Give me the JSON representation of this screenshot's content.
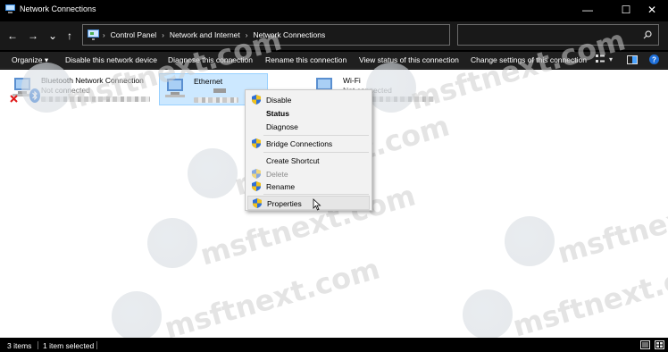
{
  "window": {
    "title": "Network Connections"
  },
  "window_controls": {
    "minimize": "—",
    "maximize": "☐",
    "close": "✕"
  },
  "nav": {
    "back": "←",
    "forward": "→",
    "recent": "⌄",
    "up": "↑"
  },
  "breadcrumb": [
    "Control Panel",
    "Network and Internet",
    "Network Connections"
  ],
  "search": {
    "placeholder": "",
    "value": ""
  },
  "toolbar": {
    "organize": "Organize ▾",
    "disable_device": "Disable this network device",
    "diagnose": "Diagnose this connection",
    "rename": "Rename this connection",
    "view_status": "View status of this connection",
    "change_settings": "Change settings of this connection"
  },
  "connections": [
    {
      "name": "Bluetooth Network Connection",
      "status": "Not connected",
      "selected": false,
      "disabled": true
    },
    {
      "name": "Ethernet",
      "status": "",
      "selected": true,
      "disabled": false
    },
    {
      "name": "Wi-Fi",
      "status": "Not connected",
      "selected": false,
      "disabled": false
    }
  ],
  "context_menu": [
    {
      "label": "Disable",
      "shield": true,
      "bold": false,
      "disabled": false
    },
    {
      "label": "Status",
      "shield": false,
      "bold": true,
      "disabled": false
    },
    {
      "label": "Diagnose",
      "shield": false,
      "bold": false,
      "disabled": false
    },
    {
      "label": "Bridge Connections",
      "shield": true,
      "bold": false,
      "disabled": false
    },
    {
      "label": "Create Shortcut",
      "shield": false,
      "bold": false,
      "disabled": false
    },
    {
      "label": "Delete",
      "shield": true,
      "bold": false,
      "disabled": true
    },
    {
      "label": "Rename",
      "shield": true,
      "bold": false,
      "disabled": false
    },
    {
      "label": "Properties",
      "shield": true,
      "bold": false,
      "disabled": false,
      "hover": true
    }
  ],
  "statusbar": {
    "items_count": "3 items",
    "selected_count": "1 item selected"
  },
  "watermark": "msftnext.com",
  "colors": {
    "selection": "#cce8ff",
    "selection_border": "#99d1ff",
    "shield_blue": "#2f6fd6",
    "shield_yellow": "#f2c21b"
  },
  "icons": [
    "app-icon",
    "control-panel-icon",
    "search-icon",
    "refresh-icon",
    "network-adapter-icon",
    "bluetooth-icon",
    "disabled-x-icon",
    "shield-icon",
    "details-view-icon",
    "large-icons-view-icon",
    "help-icon",
    "pane-icon"
  ]
}
